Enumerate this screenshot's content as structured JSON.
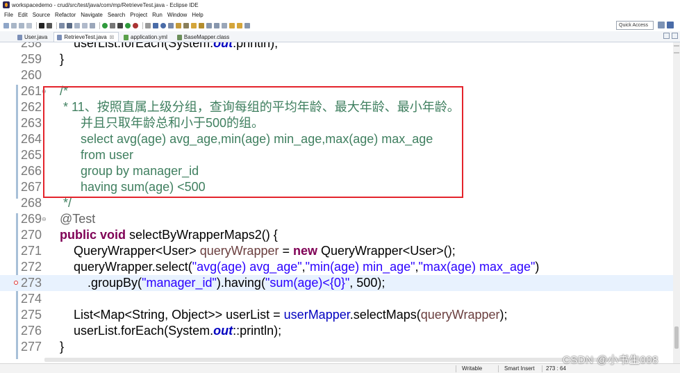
{
  "window": {
    "title": "workspacedemo - crud/src/test/java/com/mp/RetrieveTest.java - Eclipse IDE"
  },
  "menu": [
    "File",
    "Edit",
    "Source",
    "Refactor",
    "Navigate",
    "Search",
    "Project",
    "Run",
    "Window",
    "Help"
  ],
  "toolbar": {
    "quick_access_label": "Quick Access"
  },
  "tabs": [
    {
      "label": "User.java",
      "active": false,
      "closable": false,
      "icon_color": "#7b8fb8"
    },
    {
      "label": "RetrieveTest.java",
      "active": true,
      "closable": true,
      "close_glyph": "☒",
      "icon_color": "#7b8fb8"
    },
    {
      "label": "application.yml",
      "active": false,
      "closable": false,
      "icon_color": "#5aa04a"
    },
    {
      "label": "BaseMapper.class",
      "active": false,
      "closable": false,
      "icon_color": "#6b8e5a"
    }
  ],
  "editor": {
    "lines": [
      {
        "no": "258",
        "parts": [
          [
            "        userList.forEach(System.",
            ""
          ],
          [
            "out",
            "static"
          ],
          [
            ".println);",
            ""
          ]
        ]
      },
      {
        "no": "259",
        "parts": [
          [
            "    }",
            ""
          ]
        ]
      },
      {
        "no": "260",
        "parts": [
          [
            "",
            ""
          ]
        ]
      },
      {
        "no": "261",
        "parts": [
          [
            "    /*",
            "cm"
          ]
        ],
        "fold": "⊖"
      },
      {
        "no": "262",
        "parts": [
          [
            "     * 11、按照直属上级分组，查询每组的平均年龄、最大年龄、最小年龄。",
            "cm"
          ]
        ]
      },
      {
        "no": "263",
        "parts": [
          [
            "          并且只取年龄总和小于500的组。",
            "cm"
          ]
        ]
      },
      {
        "no": "264",
        "parts": [
          [
            "          select avg(age) avg_age,min(age) min_age,max(age) max_age",
            "cm"
          ]
        ]
      },
      {
        "no": "265",
        "parts": [
          [
            "          from user",
            "cm"
          ]
        ]
      },
      {
        "no": "266",
        "parts": [
          [
            "          group by manager_id",
            "cm"
          ]
        ]
      },
      {
        "no": "267",
        "parts": [
          [
            "          having sum(age) <500",
            "cm"
          ]
        ]
      },
      {
        "no": "268",
        "parts": [
          [
            "     */",
            "cm"
          ]
        ]
      },
      {
        "no": "269",
        "parts": [
          [
            "    @Test",
            "ann"
          ]
        ],
        "fold": "⊖"
      },
      {
        "no": "270",
        "parts": [
          [
            "    ",
            ""
          ],
          [
            "public",
            "kw"
          ],
          [
            " ",
            ""
          ],
          [
            "void",
            "kw"
          ],
          [
            " selectByWrapperMaps2() {",
            ""
          ]
        ]
      },
      {
        "no": "271",
        "parts": [
          [
            "        QueryWrapper<User> ",
            ""
          ],
          [
            "queryWrapper",
            "var"
          ],
          [
            " = ",
            ""
          ],
          [
            "new",
            "kw"
          ],
          [
            " QueryWrapper<User>();",
            ""
          ]
        ]
      },
      {
        "no": "272",
        "parts": [
          [
            "        queryWrapper.select(",
            ""
          ],
          [
            "\"avg(age) avg_age\"",
            "str"
          ],
          [
            ",",
            ""
          ],
          [
            "\"min(age) min_age\"",
            "str"
          ],
          [
            ",",
            ""
          ],
          [
            "\"max(age) max_age\"",
            "str"
          ],
          [
            ")",
            ""
          ]
        ]
      },
      {
        "no": "273",
        "parts": [
          [
            "            .groupBy(",
            ""
          ],
          [
            "\"manager_id\"",
            "str"
          ],
          [
            ").having(",
            ""
          ],
          [
            "\"sum(age)<{0}\"",
            "str"
          ],
          [
            ", 500);",
            ""
          ]
        ],
        "current": true,
        "breakpoint": true
      },
      {
        "no": "274",
        "parts": [
          [
            "",
            ""
          ]
        ]
      },
      {
        "no": "275",
        "parts": [
          [
            "        List<Map<String, Object>> userList = ",
            ""
          ],
          [
            "userMapper",
            "fld"
          ],
          [
            ".selectMaps(",
            ""
          ],
          [
            "queryWrapper",
            "var"
          ],
          [
            ");",
            ""
          ]
        ]
      },
      {
        "no": "276",
        "parts": [
          [
            "        userList.forEach(System.",
            ""
          ],
          [
            "out",
            "static"
          ],
          [
            "::println);",
            ""
          ]
        ]
      },
      {
        "no": "277",
        "parts": [
          [
            "    }",
            ""
          ]
        ]
      }
    ]
  },
  "status": {
    "mode": "Writable",
    "insert": "Smart Insert",
    "position": "273 : 64"
  },
  "watermark": "CSDN @小书生008",
  "colors": {
    "highlight_box": "#e4232b",
    "keyword": "#7f0055",
    "comment": "#3f7f5f",
    "string": "#2a00ff"
  }
}
